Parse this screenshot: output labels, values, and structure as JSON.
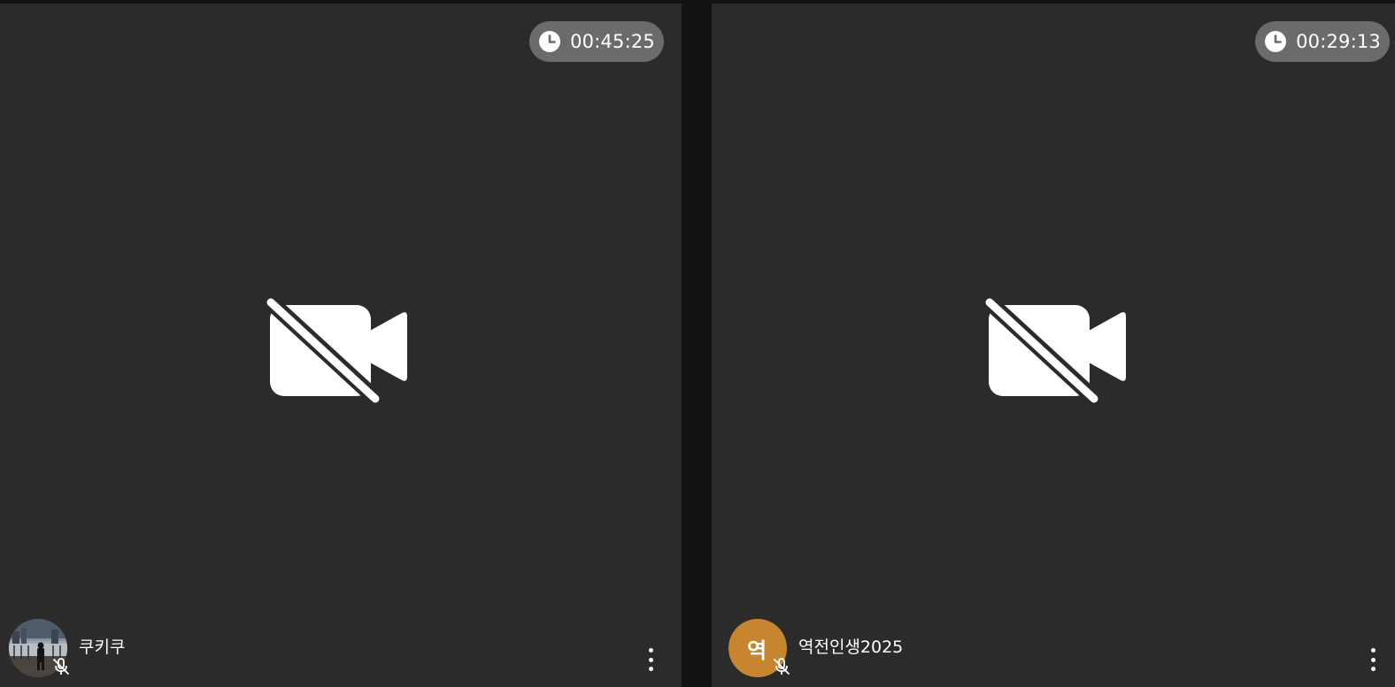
{
  "participants": [
    {
      "name": "쿠키쿠",
      "timer": "00:45:25",
      "avatar_type": "photo",
      "avatar_initial": "",
      "camera_icon": "camera-off-icon",
      "mic_icon": "mic-off-icon",
      "timer_icon": "clock-icon",
      "menu_icon": "more-vertical-icon"
    },
    {
      "name": "역전인생2025",
      "timer": "00:29:13",
      "avatar_type": "initial",
      "avatar_initial": "역",
      "avatar_color": "#c7852f",
      "camera_icon": "camera-off-icon",
      "mic_icon": "mic-off-icon",
      "timer_icon": "clock-icon",
      "menu_icon": "more-vertical-icon"
    }
  ],
  "colors": {
    "page_background": "#121212",
    "tile_background": "#2b2b2b",
    "timer_background": "#6b6b6b",
    "avatar_initial_background": "#c7852f",
    "foreground": "#ffffff"
  }
}
